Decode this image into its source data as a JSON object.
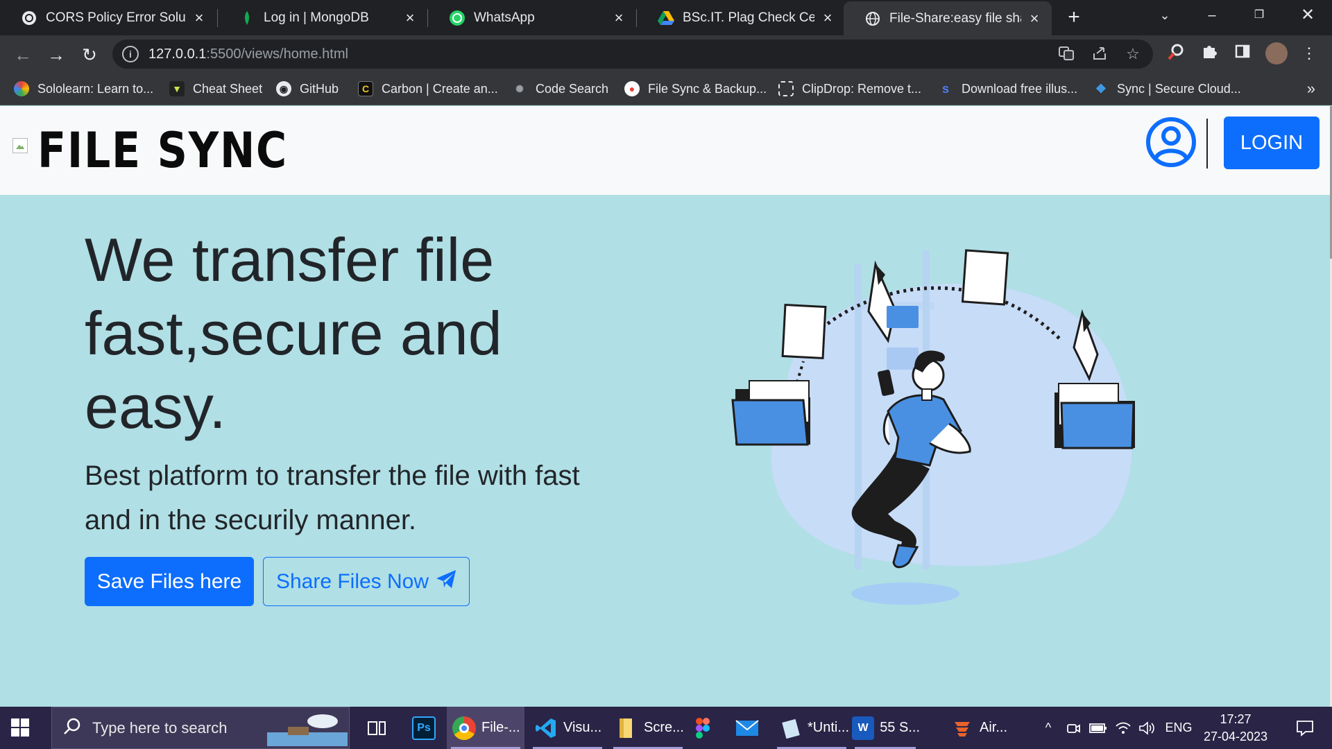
{
  "browser": {
    "tabs": [
      {
        "title": "CORS Policy Error Solution",
        "icon": "chatgpt-icon"
      },
      {
        "title": "Log in | MongoDB",
        "icon": "mongodb-icon"
      },
      {
        "title": "WhatsApp",
        "icon": "whatsapp-icon"
      },
      {
        "title": "BSc.IT. Plag Check Certificate",
        "icon": "google-drive-icon"
      },
      {
        "title": "File-Share:easy file sharing",
        "icon": "globe-icon",
        "active": true
      }
    ],
    "address": {
      "host": "127.0.0.1",
      "rest": ":5500/views/home.html"
    },
    "bookmarks": [
      {
        "label": "Sololearn: Learn to...",
        "icon": "sololearn-icon"
      },
      {
        "label": "Cheat Sheet",
        "icon": "cheatsheet-icon"
      },
      {
        "label": "GitHub",
        "icon": "github-icon"
      },
      {
        "label": "Carbon | Create an...",
        "icon": "carbon-icon"
      },
      {
        "label": "Code Search",
        "icon": "code-search-icon"
      },
      {
        "label": "File Sync & Backup...",
        "icon": "filesync-icon"
      },
      {
        "label": "ClipDrop: Remove t...",
        "icon": "clipdrop-icon"
      },
      {
        "label": "Download free illus...",
        "icon": "storyset-icon"
      },
      {
        "label": "Sync | Secure Cloud...",
        "icon": "sync-icon"
      }
    ],
    "bookmarks_more": "»"
  },
  "site": {
    "brand": "FILE SYNC",
    "login_label": "LOGIN",
    "hero_title": "We transfer file fast,secure and easy.",
    "hero_subtitle": "Best platform to transfer the file with fast and in the securily manner.",
    "save_button": "Save Files here",
    "share_button": "Share Files Now",
    "colors": {
      "primary": "#0d6efd",
      "hero_bg": "#b0dfe5",
      "header_bg": "#f8f9fa"
    }
  },
  "taskbar": {
    "search_placeholder": "Type here to search",
    "apps": [
      {
        "label": "",
        "icon": "task-view-icon"
      },
      {
        "label": "",
        "icon": "photoshop-icon"
      },
      {
        "label": "File-...",
        "icon": "chrome-icon"
      },
      {
        "label": "Visu...",
        "icon": "vscode-icon"
      },
      {
        "label": "Scre...",
        "icon": "file-explorer-icon"
      },
      {
        "label": "",
        "icon": "figma-icon"
      },
      {
        "label": "",
        "icon": "mail-icon"
      },
      {
        "label": "*Unti...",
        "icon": "notepad-icon"
      },
      {
        "label": "55 S...",
        "icon": "word-icon"
      },
      {
        "label": "Air...",
        "icon": "airtable-icon"
      }
    ],
    "language": "ENG",
    "time": "17:27",
    "date": "27-04-2023"
  }
}
